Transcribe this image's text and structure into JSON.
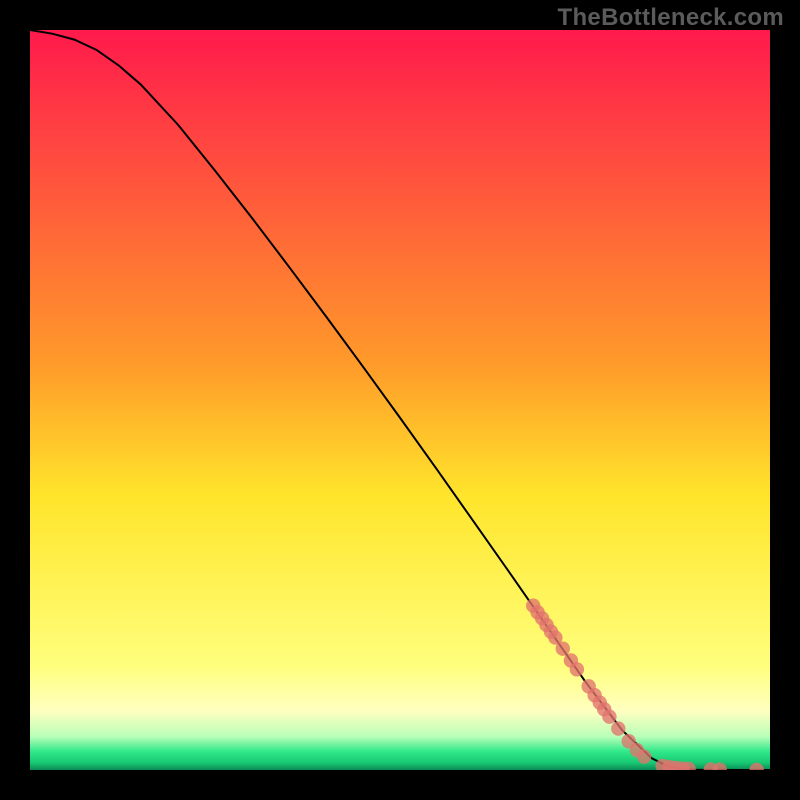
{
  "branding": {
    "watermark": "TheBottleneck.com"
  },
  "chart_data": {
    "type": "line",
    "title": "",
    "xlabel": "",
    "ylabel": "",
    "xlim": [
      0,
      100
    ],
    "ylim": [
      0,
      100
    ],
    "grid": false,
    "description": "Monotone decreasing bottleneck curve from ~100% at x=0 down to 0% near x≈88, flat at 0 thereafter. Scatter points highlight the lower-right segment of the curve.",
    "background_gradient": {
      "stops": [
        {
          "offset": 0.0,
          "color": "#ff1a4c"
        },
        {
          "offset": 0.45,
          "color": "#ff9a2a"
        },
        {
          "offset": 0.63,
          "color": "#ffe52b"
        },
        {
          "offset": 0.86,
          "color": "#ffff7d"
        },
        {
          "offset": 0.92,
          "color": "#ffffc0"
        },
        {
          "offset": 0.955,
          "color": "#b8ffb8"
        },
        {
          "offset": 0.975,
          "color": "#30e88a"
        },
        {
          "offset": 0.99,
          "color": "#18c973"
        },
        {
          "offset": 1.0,
          "color": "#0c8a55"
        }
      ]
    },
    "series": [
      {
        "name": "bottleneck-curve",
        "x": [
          0,
          3,
          6,
          9,
          12,
          15,
          20,
          25,
          30,
          35,
          40,
          45,
          50,
          55,
          60,
          65,
          70,
          75,
          80,
          84,
          86,
          88,
          90,
          93,
          96,
          100
        ],
        "y": [
          100,
          99.5,
          98.7,
          97.3,
          95.2,
          92.6,
          87.2,
          81.0,
          74.6,
          68.0,
          61.3,
          54.5,
          47.6,
          40.6,
          33.5,
          26.4,
          19.2,
          12.0,
          5.4,
          1.6,
          0.6,
          0.12,
          0.04,
          0.015,
          0.006,
          0.002
        ]
      }
    ],
    "scatter": [
      {
        "x": 68.0,
        "y": 22.2
      },
      {
        "x": 68.6,
        "y": 21.3
      },
      {
        "x": 69.2,
        "y": 20.5
      },
      {
        "x": 69.8,
        "y": 19.6
      },
      {
        "x": 70.4,
        "y": 18.7
      },
      {
        "x": 71.0,
        "y": 17.9
      },
      {
        "x": 72.0,
        "y": 16.4
      },
      {
        "x": 73.1,
        "y": 14.8
      },
      {
        "x": 73.9,
        "y": 13.6
      },
      {
        "x": 75.5,
        "y": 11.3
      },
      {
        "x": 76.3,
        "y": 10.1
      },
      {
        "x": 77.0,
        "y": 9.1
      },
      {
        "x": 77.6,
        "y": 8.2
      },
      {
        "x": 78.3,
        "y": 7.2
      },
      {
        "x": 79.5,
        "y": 5.6
      },
      {
        "x": 80.9,
        "y": 3.9
      },
      {
        "x": 82.0,
        "y": 2.7
      },
      {
        "x": 83.0,
        "y": 1.8
      },
      {
        "x": 85.5,
        "y": 0.55
      },
      {
        "x": 86.4,
        "y": 0.4
      },
      {
        "x": 87.3,
        "y": 0.28
      },
      {
        "x": 88.2,
        "y": 0.2
      },
      {
        "x": 89.0,
        "y": 0.14
      },
      {
        "x": 92.0,
        "y": 0.06
      },
      {
        "x": 93.2,
        "y": 0.04
      },
      {
        "x": 98.2,
        "y": 0.01
      }
    ]
  }
}
